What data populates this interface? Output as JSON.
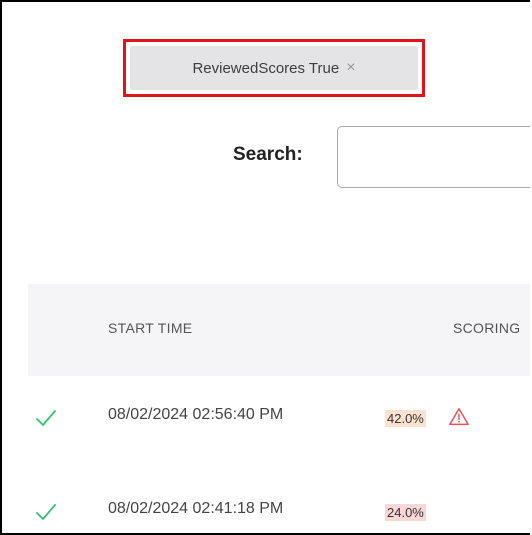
{
  "filter": {
    "label": "ReviewedScores True",
    "close_glyph": "×"
  },
  "search": {
    "label": "Search:",
    "value": "",
    "placeholder": ""
  },
  "table": {
    "columns": [
      "START TIME",
      "SCORING"
    ],
    "rows": [
      {
        "status_icon": "check-icon",
        "start_time": "08/02/2024 02:56:40 PM",
        "score": "42.0%",
        "score_bg": "#fde3cf",
        "warning": true
      },
      {
        "status_icon": "check-icon",
        "start_time": "08/02/2024 02:41:18 PM",
        "score": "24.0%",
        "score_bg": "#f9d7d9",
        "warning": false
      }
    ]
  },
  "colors": {
    "accent_red": "#e2141a",
    "check_green": "#38c172",
    "warn_red": "#e8505b"
  }
}
